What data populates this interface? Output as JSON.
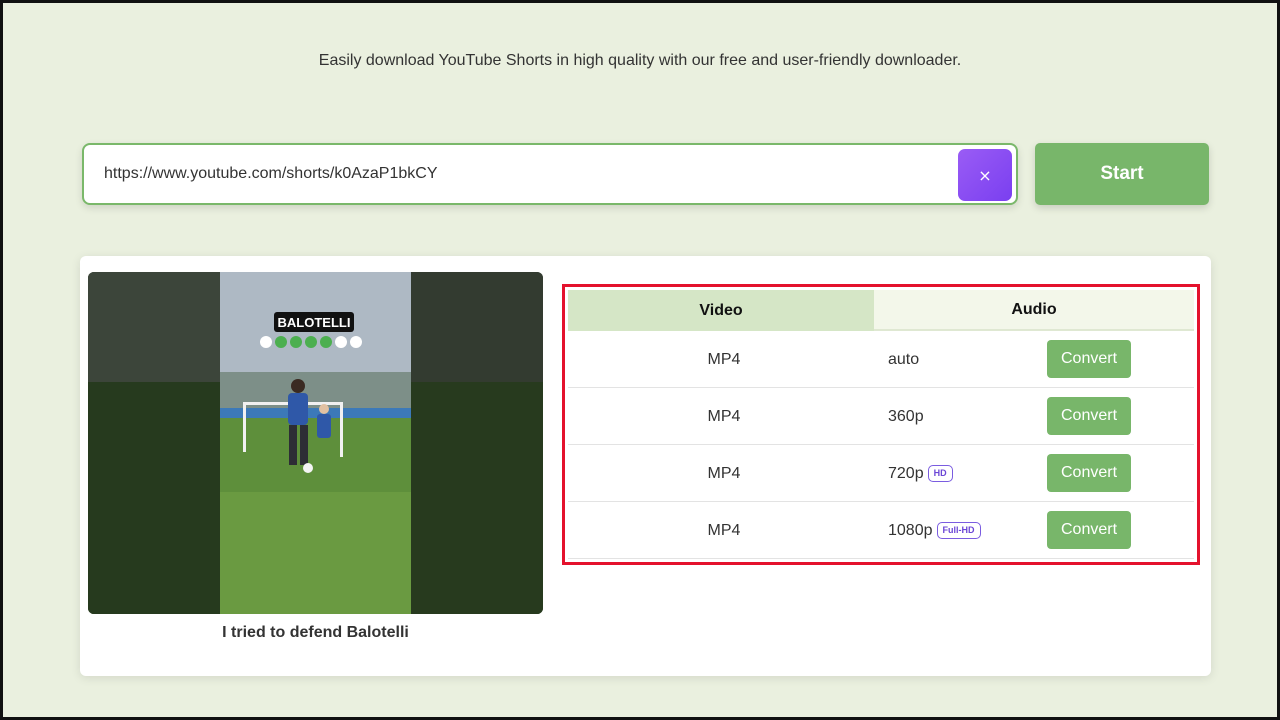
{
  "tagline": "Easily download YouTube Shorts in high quality with our free and user-friendly downloader.",
  "search": {
    "value": "https://www.youtube.com/shorts/k0AzaP1bkCY",
    "clear_label": "×"
  },
  "start_label": "Start",
  "video": {
    "title": "I tried to defend Balotelli",
    "overlay_text": "BALOTELLI"
  },
  "tabs": {
    "video": "Video",
    "audio": "Audio"
  },
  "formats": [
    {
      "format": "MP4",
      "quality": "auto",
      "badge": "",
      "action": "Convert"
    },
    {
      "format": "MP4",
      "quality": "360p",
      "badge": "",
      "action": "Convert"
    },
    {
      "format": "MP4",
      "quality": "720p",
      "badge": "HD",
      "action": "Convert"
    },
    {
      "format": "MP4",
      "quality": "1080p",
      "badge": "Full-HD",
      "action": "Convert"
    }
  ],
  "colors": {
    "page_bg": "#eaf0df",
    "accent_green": "#78b66a",
    "clear_purple": "#8a4ef2",
    "highlight_red": "#e4122d",
    "badge_purple": "#6b46d6"
  }
}
